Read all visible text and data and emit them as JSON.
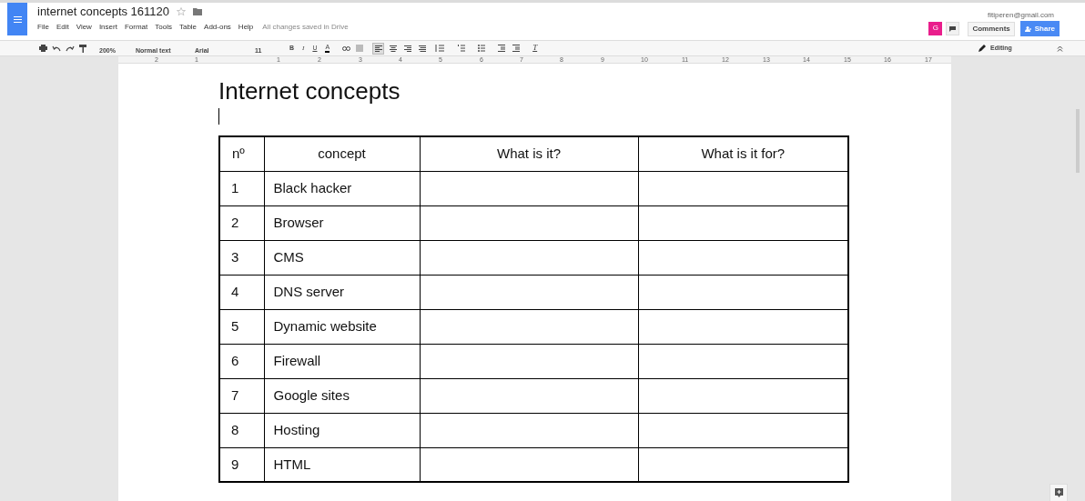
{
  "document": {
    "title": "internet concepts 161120",
    "starred": false
  },
  "menu": [
    "File",
    "Edit",
    "View",
    "Insert",
    "Format",
    "Tools",
    "Table",
    "Add-ons",
    "Help"
  ],
  "save_status": "All changes saved in Drive",
  "account": {
    "email": "fitiperen@gmail.com",
    "avatar_letter": "G"
  },
  "buttons": {
    "comments": "Comments",
    "share": "Share"
  },
  "toolbar": {
    "zoom": "200%",
    "style": "Normal text",
    "font": "Arial",
    "size": "11",
    "format": [
      {
        "kind": "bold",
        "label": "B"
      },
      {
        "kind": "italic",
        "label": "I"
      },
      {
        "kind": "underline",
        "label": "U"
      },
      {
        "kind": "color",
        "label": "A"
      }
    ],
    "alignment": [
      {
        "kind": "left",
        "selected": true
      },
      {
        "kind": "center",
        "selected": false
      },
      {
        "kind": "right",
        "selected": false
      },
      {
        "kind": "justify",
        "selected": false
      }
    ],
    "clear_format": "T",
    "mode": "Editing"
  },
  "ruler": [
    "2",
    "1",
    "1",
    "2",
    "3",
    "4",
    "5",
    "6",
    "7",
    "8",
    "9",
    "10",
    "11",
    "12",
    "13",
    "14",
    "15",
    "16",
    "17"
  ],
  "heading": "Internet concepts",
  "table": {
    "columns": [
      "nº",
      "concept",
      "What is it?",
      "What is it for?"
    ],
    "rows": [
      [
        "1",
        "Black hacker",
        "",
        ""
      ],
      [
        "2",
        "Browser",
        "",
        ""
      ],
      [
        "3",
        "CMS",
        "",
        ""
      ],
      [
        "4",
        "DNS server",
        "",
        ""
      ],
      [
        "5",
        "Dynamic website",
        "",
        ""
      ],
      [
        "6",
        "Firewall",
        "",
        ""
      ],
      [
        "7",
        "Google sites",
        "",
        ""
      ],
      [
        "8",
        "Hosting",
        "",
        ""
      ],
      [
        "9",
        "HTML",
        "",
        ""
      ]
    ]
  }
}
